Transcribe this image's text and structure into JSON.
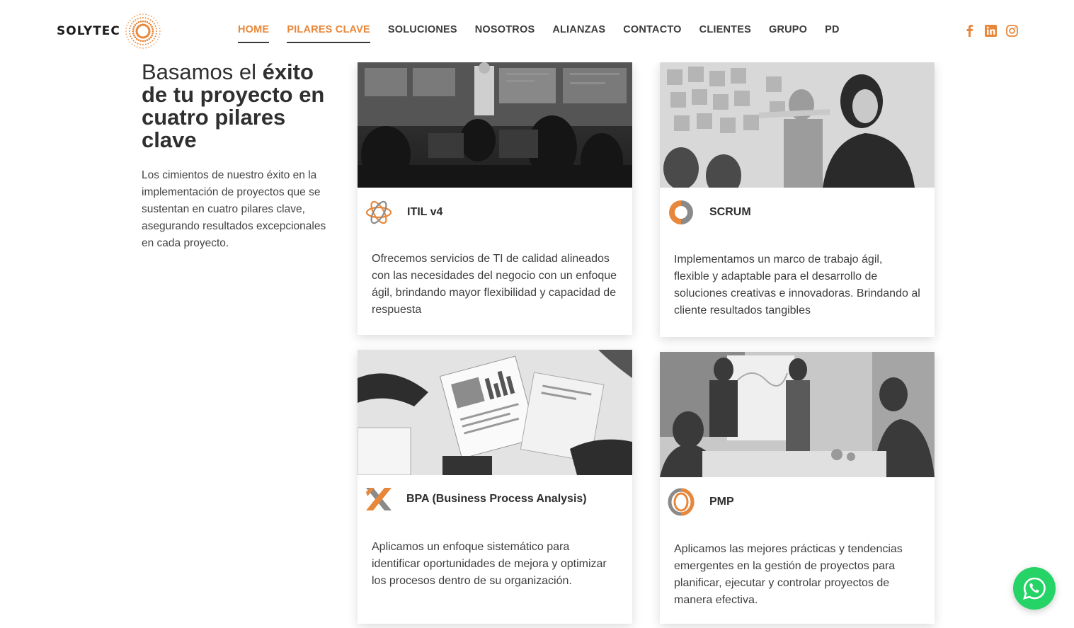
{
  "brand": {
    "name": "SOLYTEC",
    "accent": "#e8873a",
    "dark": "#3b3b3b"
  },
  "nav": [
    {
      "label": "HOME"
    },
    {
      "label": "PILARES CLAVE"
    },
    {
      "label": "SOLUCIONES"
    },
    {
      "label": "NOSOTROS"
    },
    {
      "label": "ALIANZAS"
    },
    {
      "label": "CONTACTO"
    },
    {
      "label": "CLIENTES"
    },
    {
      "label": "GRUPO"
    },
    {
      "label": "PD"
    }
  ],
  "social": [
    "facebook-icon",
    "linkedin-icon",
    "instagram-icon"
  ],
  "intro": {
    "title_part1": "Basamos el ",
    "title_bold": "éxito de tu proyecto en cuatro pilares clave",
    "text": "Los cimientos de nuestro éxito en la implementación de proyectos que se sustentan en cuatro pilares clave, asegurando resultados excepcionales en cada proyecto."
  },
  "cards": [
    {
      "title": "ITIL v4",
      "icon": "itil-star-icon",
      "image": "operations-center-photo",
      "desc": "Ofrecemos servicios de TI de calidad alineados con las necesidades del negocio con un enfoque ágil, brindando mayor flexibilidad y capacidad de respuesta"
    },
    {
      "title": "SCRUM",
      "icon": "scrum-cycle-icon",
      "image": "sticky-notes-team-photo",
      "desc": "Implementamos un marco de trabajo ágil, flexible y adaptable para el desarrollo de soluciones creativas e innovadoras. Brindando al cliente resultados tangibles"
    },
    {
      "title": "BPA (Business Process Analysis)",
      "icon": "bpa-cross-icon",
      "image": "business-charts-desk-photo",
      "desc": "Aplicamos un enfoque sistemático para identificar oportunidades de mejora y optimizar los procesos dentro de su organización."
    },
    {
      "title": "PMP",
      "icon": "pmp-ring-icon",
      "image": "whiteboard-meeting-photo",
      "desc": "Aplicamos las mejores prácticas y tendencias emergentes en la gestión de proyectos para planificar, ejecutar y controlar proyectos de manera efectiva."
    }
  ],
  "whatsapp": {
    "icon": "whatsapp-icon",
    "color": "#25d366"
  }
}
